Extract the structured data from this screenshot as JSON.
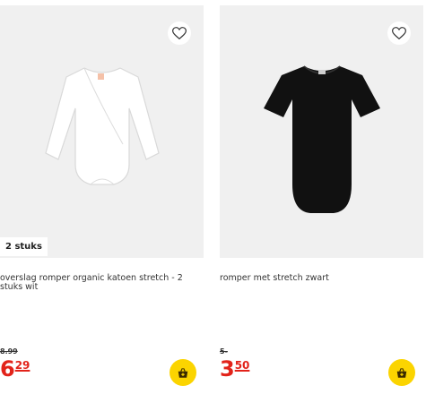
{
  "products": [
    {
      "badge": "2 stuks",
      "title": "overslag romper organic katoen stretch - 2 stuks wit",
      "old_price": "8.99",
      "price_euro": "6",
      "price_cents": "29",
      "garment_color": "#ffffff",
      "wishlist_icon": "heart-icon",
      "cart_icon": "basket-icon"
    },
    {
      "title": "romper met stretch zwart",
      "old_price": "5-",
      "price_euro": "3",
      "price_cents": "50",
      "garment_color": "#111111",
      "wishlist_icon": "heart-icon",
      "cart_icon": "basket-icon"
    }
  ],
  "colors": {
    "price_red": "#e2231a",
    "cart_yellow": "#fbd400",
    "image_bg": "#f0f0f0"
  }
}
